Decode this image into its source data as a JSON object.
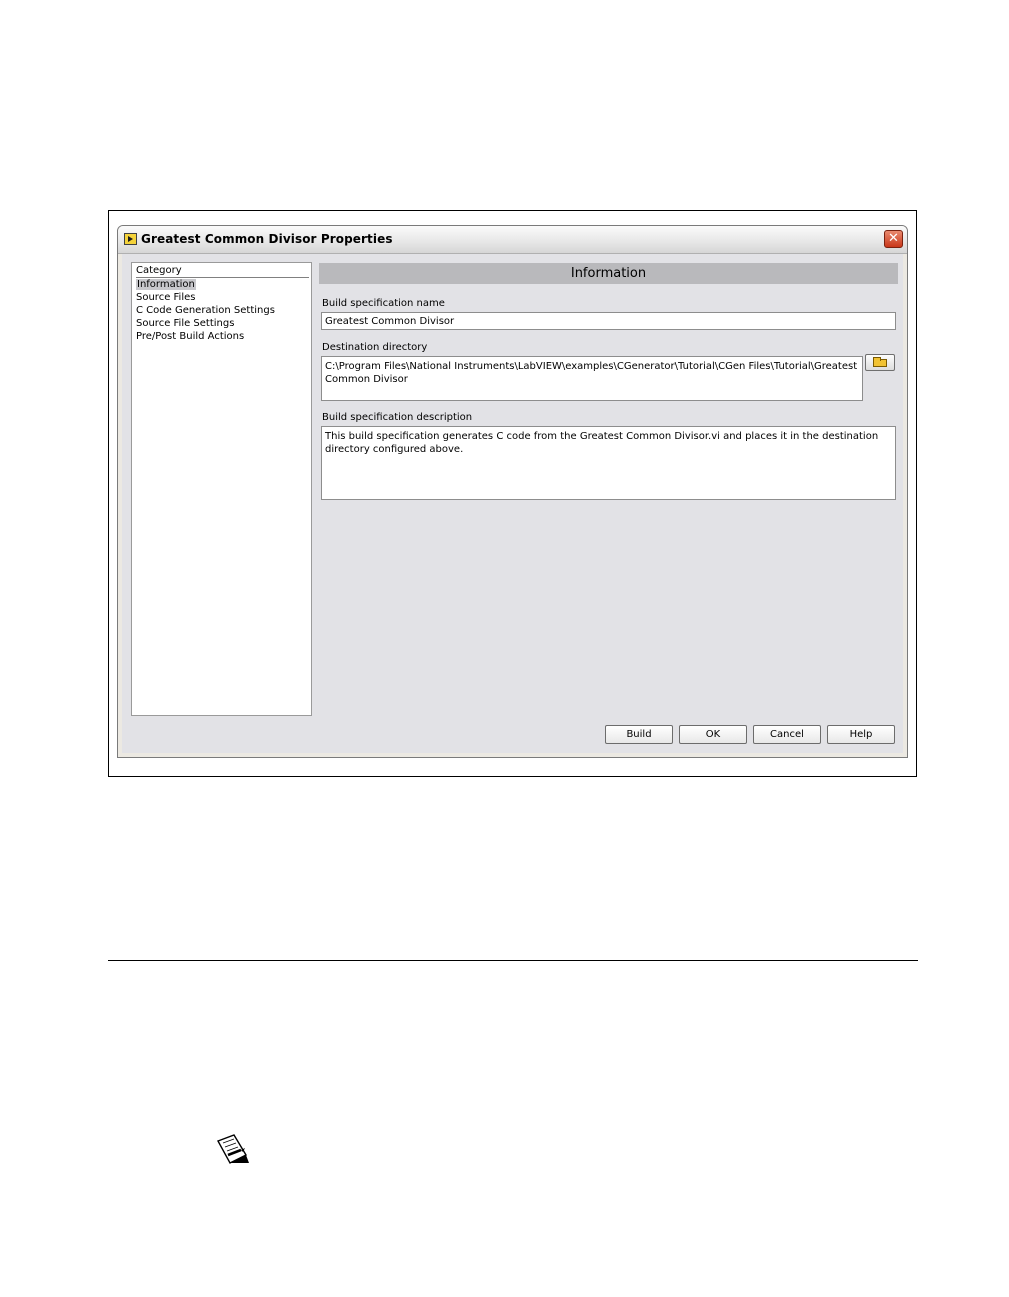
{
  "window": {
    "title": "Greatest Common Divisor Properties",
    "close_glyph": "✕",
    "icon": "labview-app-icon"
  },
  "category_panel": {
    "header": "Category",
    "items": [
      {
        "label": "Information",
        "selected": true
      },
      {
        "label": "Source Files",
        "selected": false
      },
      {
        "label": "C Code Generation Settings",
        "selected": false
      },
      {
        "label": "Source File Settings",
        "selected": false
      },
      {
        "label": "Pre/Post Build Actions",
        "selected": false
      }
    ]
  },
  "main": {
    "section_title": "Information",
    "build_name_label": "Build specification name",
    "build_name_value": "Greatest Common Divisor",
    "destination_label": "Destination directory",
    "destination_value": "C:\\Program Files\\National Instruments\\LabVIEW\\examples\\CGenerator\\Tutorial\\CGen Files\\Tutorial\\Greatest Common Divisor",
    "browse_icon": "folder-open-icon",
    "description_label": "Build specification description",
    "description_value": "This build specification generates C code from the Greatest Common Divisor.vi and places it in the destination directory configured above."
  },
  "buttons": {
    "build": "Build",
    "ok": "OK",
    "cancel": "Cancel",
    "help": "Help"
  },
  "document": {
    "note_icon": "note-pencil-icon"
  }
}
